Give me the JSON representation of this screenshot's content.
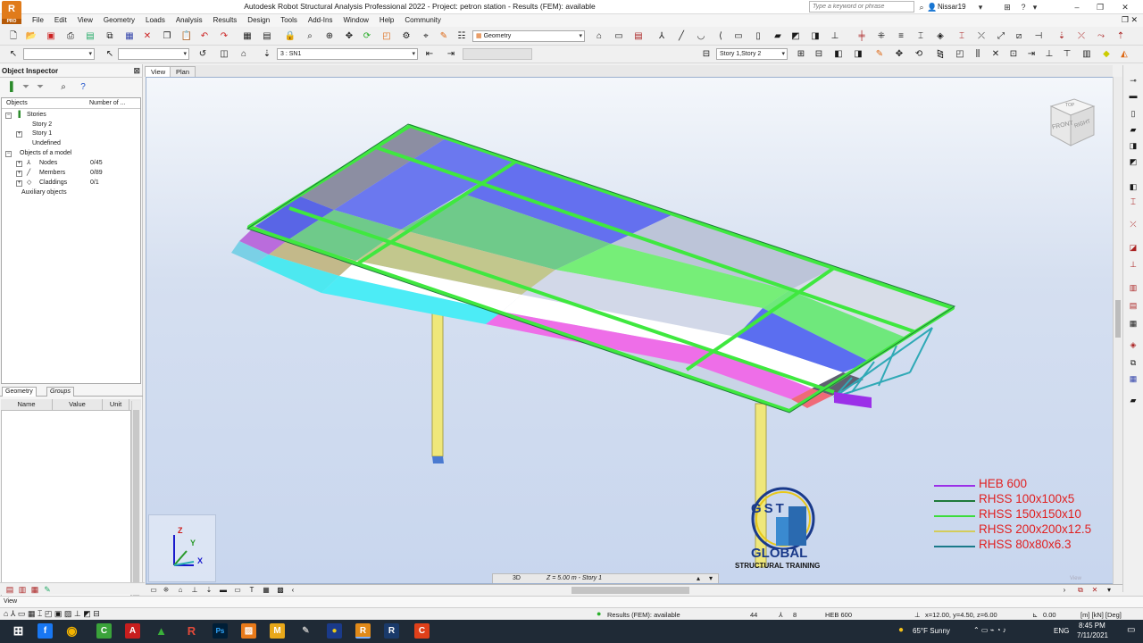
{
  "window": {
    "title": "Autodesk Robot Structural Analysis Professional 2022 - Project: petron station - Results (FEM): available",
    "logo_letter": "R",
    "logo_sub": "PRO",
    "search_placeholder": "Type a keyword or phrase",
    "user": "Nissar19"
  },
  "menu": [
    "File",
    "Edit",
    "View",
    "Geometry",
    "Loads",
    "Analysis",
    "Results",
    "Design",
    "Tools",
    "Add-Ins",
    "Window",
    "Help",
    "Community"
  ],
  "toolbar": {
    "layout_combo": "Geometry",
    "load_case_combo": "3 : SN1",
    "story_combo": "Story 1,Story 2"
  },
  "inspector": {
    "title": "Object Inspector",
    "col_objects": "Objects",
    "col_number": "Number of ...",
    "tree": [
      {
        "label": "Stories",
        "count": ""
      },
      {
        "label": "Story 2",
        "count": ""
      },
      {
        "label": "Story 1",
        "count": ""
      },
      {
        "label": "Undefined",
        "count": ""
      },
      {
        "label": "Objects of a model",
        "count": ""
      },
      {
        "label": "Nodes",
        "count": "0/45"
      },
      {
        "label": "Members",
        "count": "0/89"
      },
      {
        "label": "Claddings",
        "count": "0/1"
      },
      {
        "label": "Auxiliary objects",
        "count": ""
      }
    ],
    "tabs": [
      "Geometry",
      "Groups"
    ],
    "prop_cols": [
      "Name",
      "Value",
      "Unit"
    ]
  },
  "viewport": {
    "tabs": [
      "View",
      "Plan"
    ],
    "viewcube_front": "FRONT",
    "viewcube_right": "RIGHT",
    "viewcube_top": "TOP",
    "axis_x": "X",
    "axis_y": "Y",
    "axis_z": "Z",
    "view_label": "View",
    "view_mode": "3D",
    "elevation": "Z = 5.00 m - Story 1"
  },
  "legend": [
    {
      "label": "HEB 600",
      "color": "#9b30e8"
    },
    {
      "label": "RHSS 100x100x5",
      "color": "#1e7a3a"
    },
    {
      "label": "RHSS 150x150x10",
      "color": "#3cdc3c"
    },
    {
      "label": "RHSS 200x200x12.5",
      "color": "#d4cc5a"
    },
    {
      "label": "RHSS 80x80x6.3",
      "color": "#1a7a8a"
    }
  ],
  "watermark": {
    "line1": "GLOBAL",
    "line2": "STRUCTURAL TRAINING",
    "letters": "GST"
  },
  "status": {
    "left_label": "View",
    "results": "Results (FEM): available",
    "nodes": "44",
    "bars": "8",
    "section": "HEB 600",
    "coords": "x=12.00, y=4.50, z=6.00",
    "value": "0.00",
    "units": "[m] [kN] [Deg]"
  },
  "taskbar": {
    "weather": "65°F  Sunny",
    "lang": "ENG",
    "time": "8:45 PM",
    "date": "7/11/2021"
  }
}
